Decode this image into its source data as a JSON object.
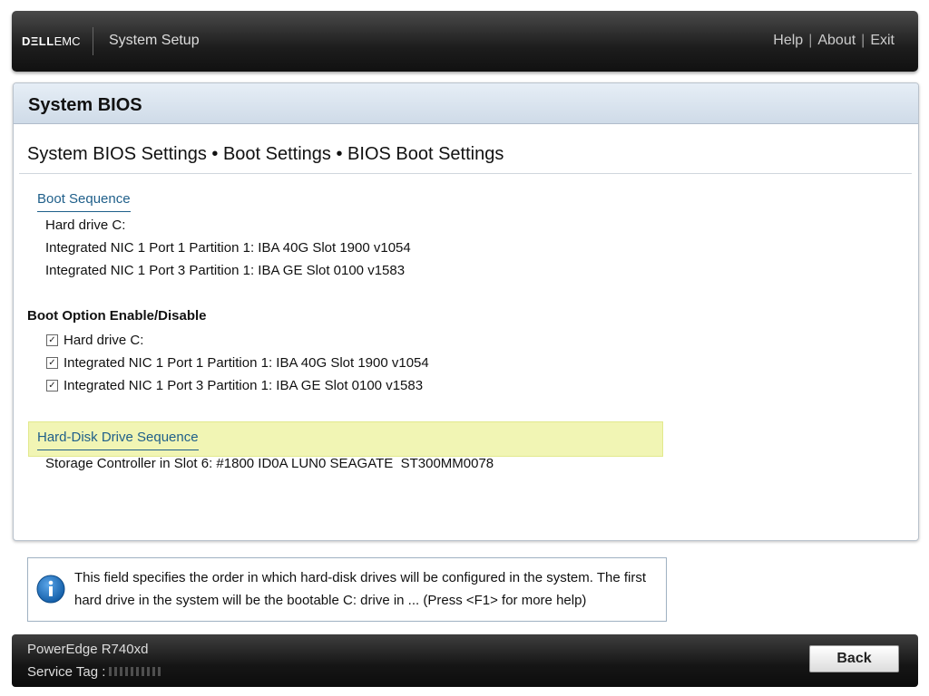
{
  "header": {
    "logo_dell": "DΞLL",
    "logo_emc": "EMC",
    "app_title": "System Setup",
    "links": [
      "Help",
      "About",
      "Exit"
    ]
  },
  "panel": {
    "title": "System BIOS",
    "breadcrumb": "System BIOS Settings • Boot Settings • BIOS Boot Settings"
  },
  "boot_sequence": {
    "label": "Boot Sequence",
    "items": [
      "Hard drive C:",
      "Integrated NIC 1 Port 1 Partition 1: IBA 40G Slot 1900 v1054",
      "Integrated NIC 1 Port 3 Partition 1: IBA GE Slot 0100 v1583"
    ]
  },
  "boot_option": {
    "heading": "Boot Option Enable/Disable",
    "items": [
      {
        "label": "Hard drive C:",
        "checked": true
      },
      {
        "label": "Integrated NIC 1 Port 1 Partition 1: IBA 40G Slot 1900 v1054",
        "checked": true
      },
      {
        "label": "Integrated NIC 1 Port 3 Partition 1: IBA GE Slot 0100 v1583",
        "checked": true
      }
    ]
  },
  "hdd_sequence": {
    "label": "Hard-Disk Drive Sequence",
    "items": [
      "Storage Controller in Slot 6: #1800 ID0A LUN0 SEAGATE  ST300MM0078"
    ]
  },
  "help": {
    "text": "This field specifies the order in which hard-disk drives will be configured in the system. The first hard drive in the system will be the bootable C: drive in ... (Press <F1> for more help)"
  },
  "footer": {
    "model": "PowerEdge R740xd",
    "service_tag_label": "Service Tag :",
    "back_label": "Back"
  },
  "colors": {
    "highlight": "#f1f5b4",
    "link": "#1f5f8a",
    "info_icon": "#1e73be"
  }
}
